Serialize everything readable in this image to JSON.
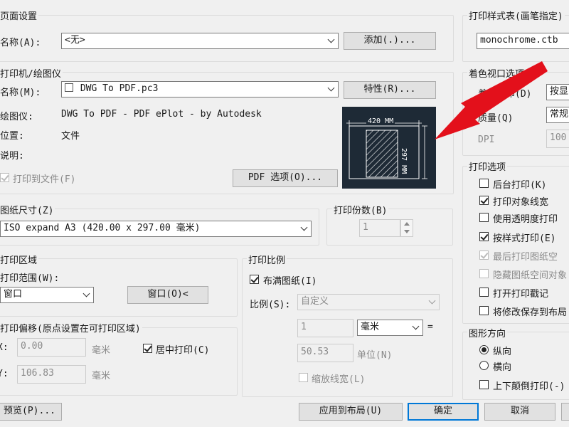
{
  "page_setup": {
    "title": "页面设置",
    "name_label": "名称(A):",
    "name_value": "<无>",
    "add_button": "添加(.)..."
  },
  "printer": {
    "title": "打印机/绘图仪",
    "name_label": "名称(M):",
    "name_value": "DWG To PDF.pc3",
    "properties_button": "特性(R)...",
    "plotter_label": "绘图仪:",
    "plotter_value": "DWG To PDF - PDF ePlot - by Autodesk",
    "location_label": "位置:",
    "location_value": "文件",
    "description_label": "说明:",
    "print_to_file": "打印到文件(F)",
    "pdf_options_button": "PDF 选项(O)...",
    "preview": {
      "width_label": "420 MM",
      "height_label": "297 MM"
    }
  },
  "paper_size": {
    "title": "图纸尺寸(Z)",
    "value": "ISO expand A3 (420.00 x 297.00 毫米)"
  },
  "copies": {
    "title": "打印份数(B)",
    "value": "1"
  },
  "plot_area": {
    "title": "打印区域",
    "range_label": "打印范围(W):",
    "range_value": "窗口",
    "window_button": "窗口(O)<"
  },
  "plot_offset": {
    "title": "打印偏移(原点设置在可打印区域)",
    "x_label": "X:",
    "x_value": "0.00",
    "x_unit": "毫米",
    "y_label": "Y:",
    "y_value": "106.83",
    "y_unit": "毫米",
    "center_label": "居中打印(C)"
  },
  "plot_scale": {
    "title": "打印比例",
    "fit_label": "布满图纸(I)",
    "scale_label": "比例(S):",
    "scale_value": "自定义",
    "value1": "1",
    "unit_value": "毫米",
    "equals": "=",
    "value2": "50.53",
    "unit_label": "单位(N)",
    "lineweight_label": "缩放线宽(L)"
  },
  "plot_style_table": {
    "title": "打印样式表(画笔指定)",
    "value": "monochrome.ctb"
  },
  "shaded_viewport": {
    "title": "着色视口选项",
    "shade_label": "着色打印(D)",
    "shade_value": "按显",
    "quality_label": "质量(Q)",
    "quality_value": "常规",
    "dpi_label": "DPI",
    "dpi_value": "100"
  },
  "plot_options": {
    "title": "打印选项",
    "items": [
      {
        "label": "后台打印(K)"
      },
      {
        "label": "打印对象线宽"
      },
      {
        "label": "使用透明度打印"
      },
      {
        "label": "按样式打印(E)"
      },
      {
        "label": "最后打印图纸空"
      },
      {
        "label": "隐藏图纸空间对象"
      },
      {
        "label": "打开打印戳记"
      },
      {
        "label": "将修改保存到布局"
      }
    ]
  },
  "orientation": {
    "title": "图形方向",
    "portrait": "纵向",
    "landscape": "横向",
    "upside_down": "上下颠倒打印(-)"
  },
  "footer": {
    "preview_button": "预览(P)...",
    "apply_button": "应用到布局(U)",
    "ok_button": "确定",
    "cancel_button": "取消"
  },
  "colors": {
    "arrow": "#e3101b",
    "preview_bg": "#1e2a36",
    "accent": "#0078d7"
  }
}
